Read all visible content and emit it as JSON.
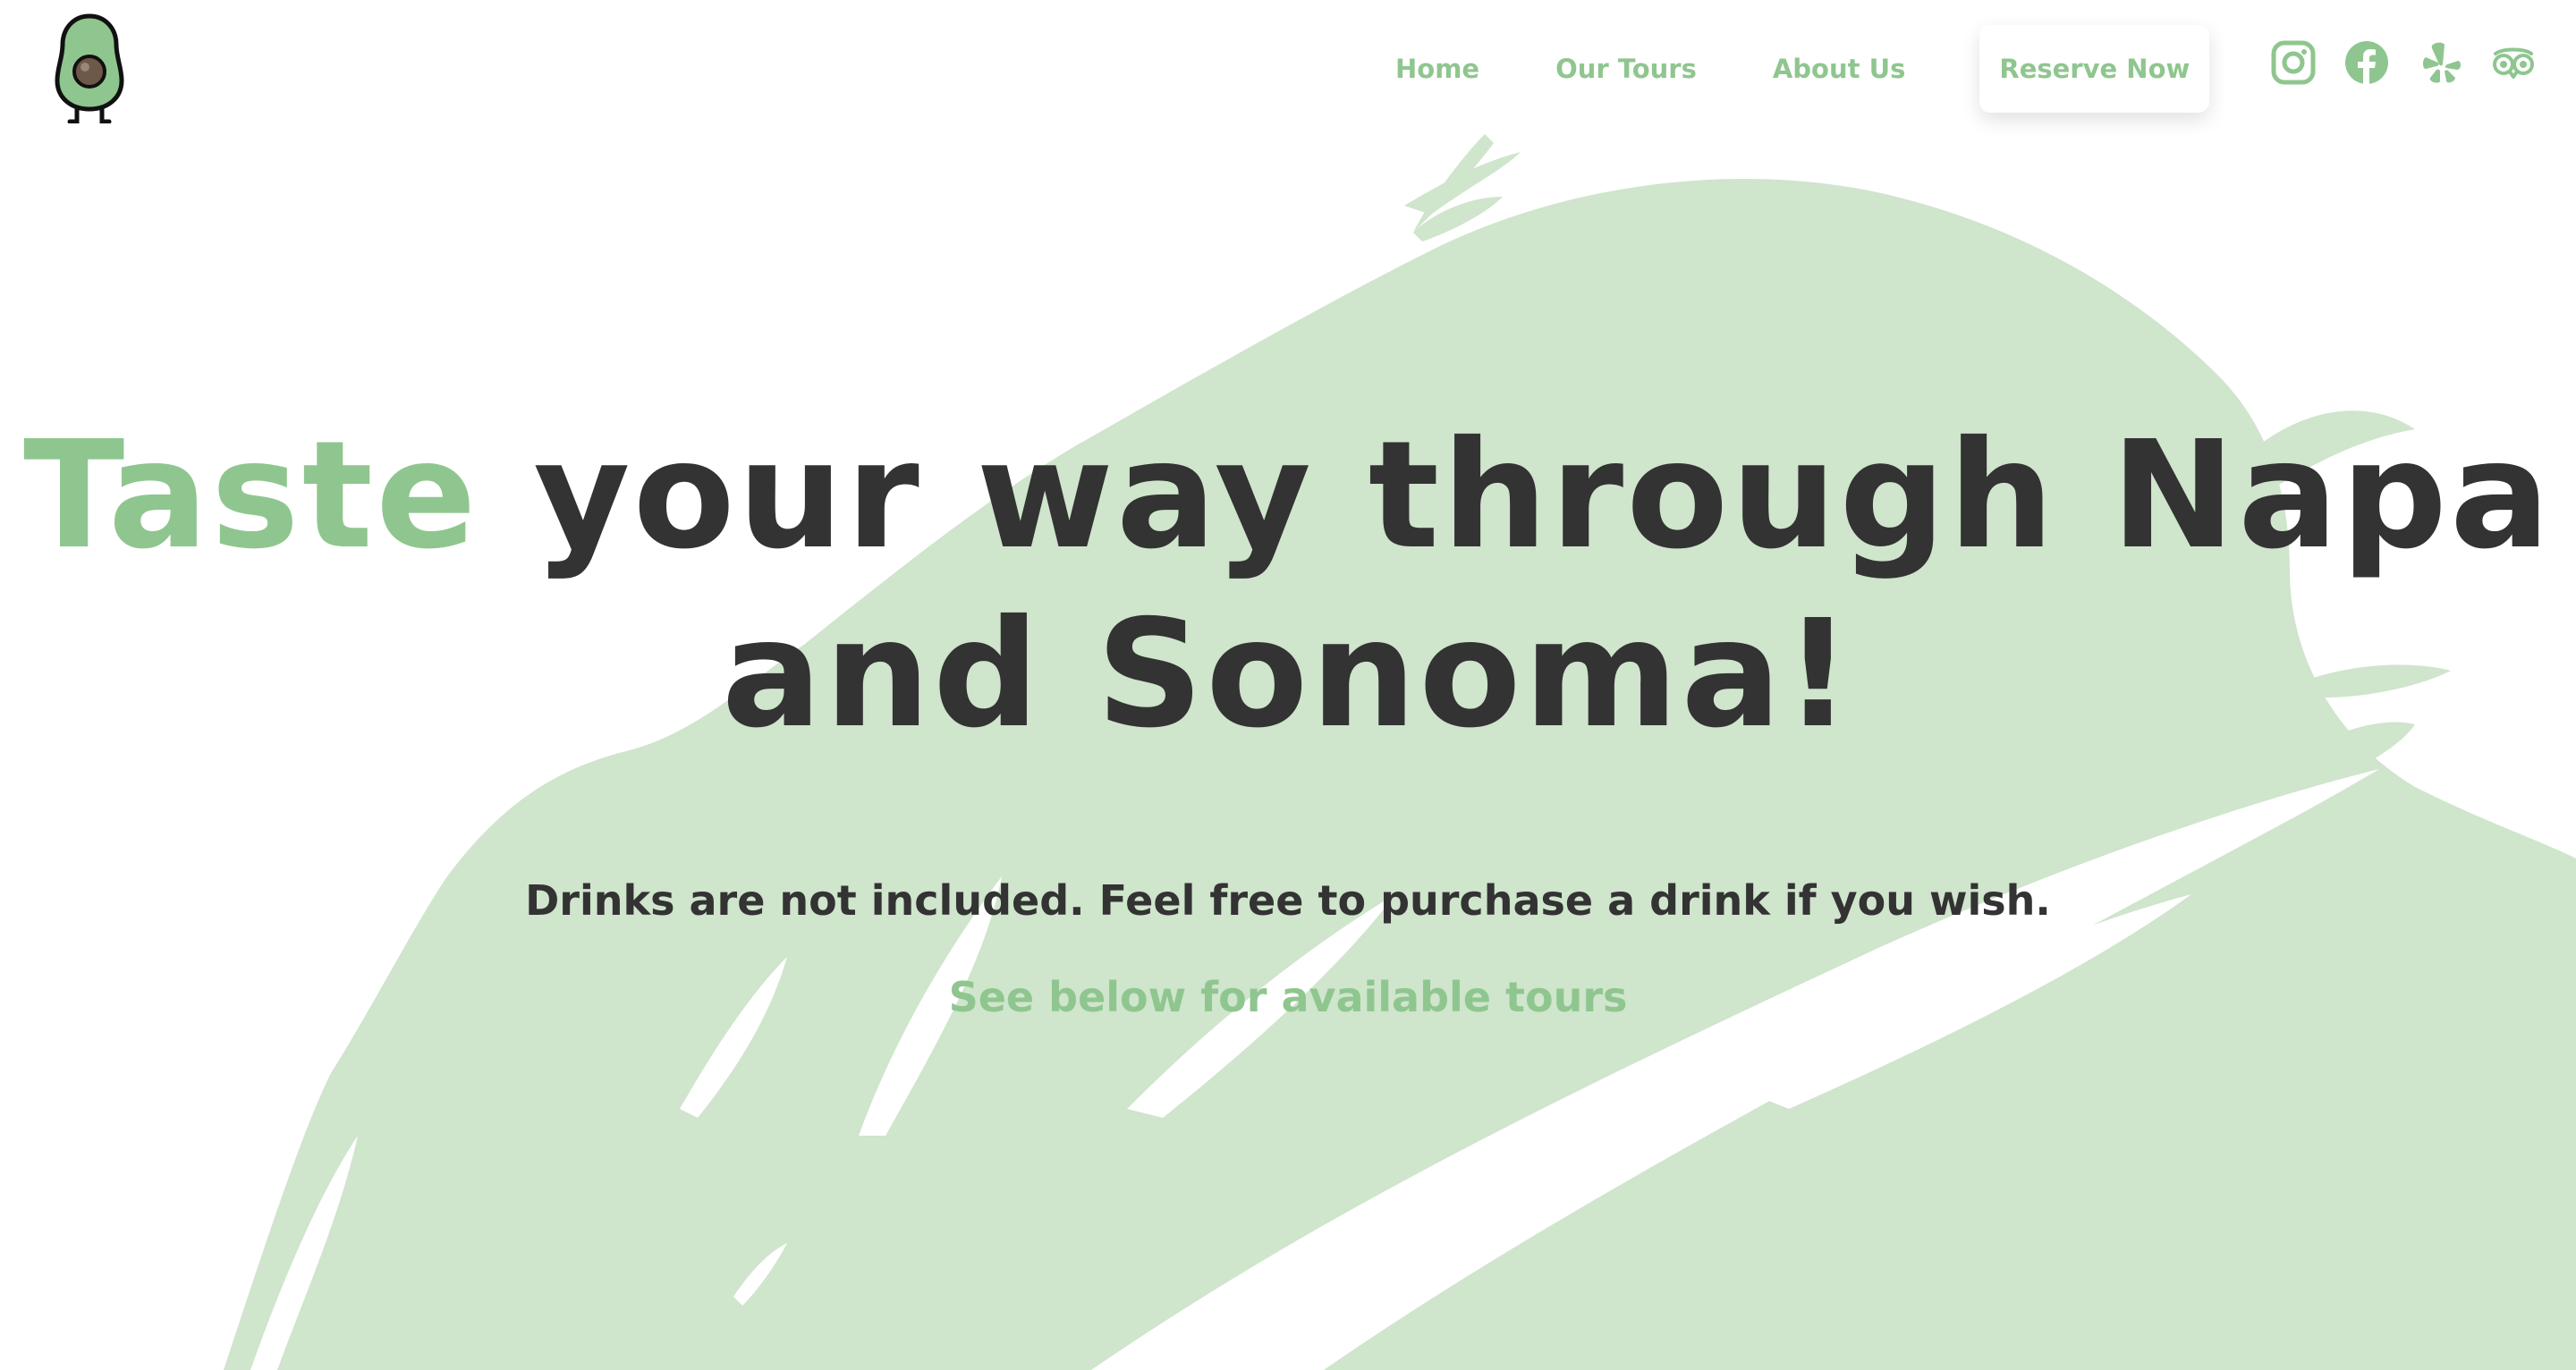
{
  "colors": {
    "accent": "#8fc68f",
    "brush": "#cfe5cc",
    "text": "#333333"
  },
  "logo": {
    "icon": "avocado-mascot-icon"
  },
  "nav": {
    "items": [
      {
        "label": "Home"
      },
      {
        "label": "Our Tours"
      },
      {
        "label": "About Us"
      }
    ],
    "reserve_label": "Reserve Now"
  },
  "socials": [
    {
      "icon": "instagram-icon"
    },
    {
      "icon": "facebook-icon"
    },
    {
      "icon": "yelp-icon"
    },
    {
      "icon": "tripadvisor-icon"
    }
  ],
  "hero": {
    "headline_accent": "Taste",
    "headline_line1_rest": " your way through Napa",
    "headline_line2": "and Sonoma!",
    "subtext": "Drinks are not included. Feel free to purchase a drink if you wish.",
    "cta": "See below for available tours"
  }
}
